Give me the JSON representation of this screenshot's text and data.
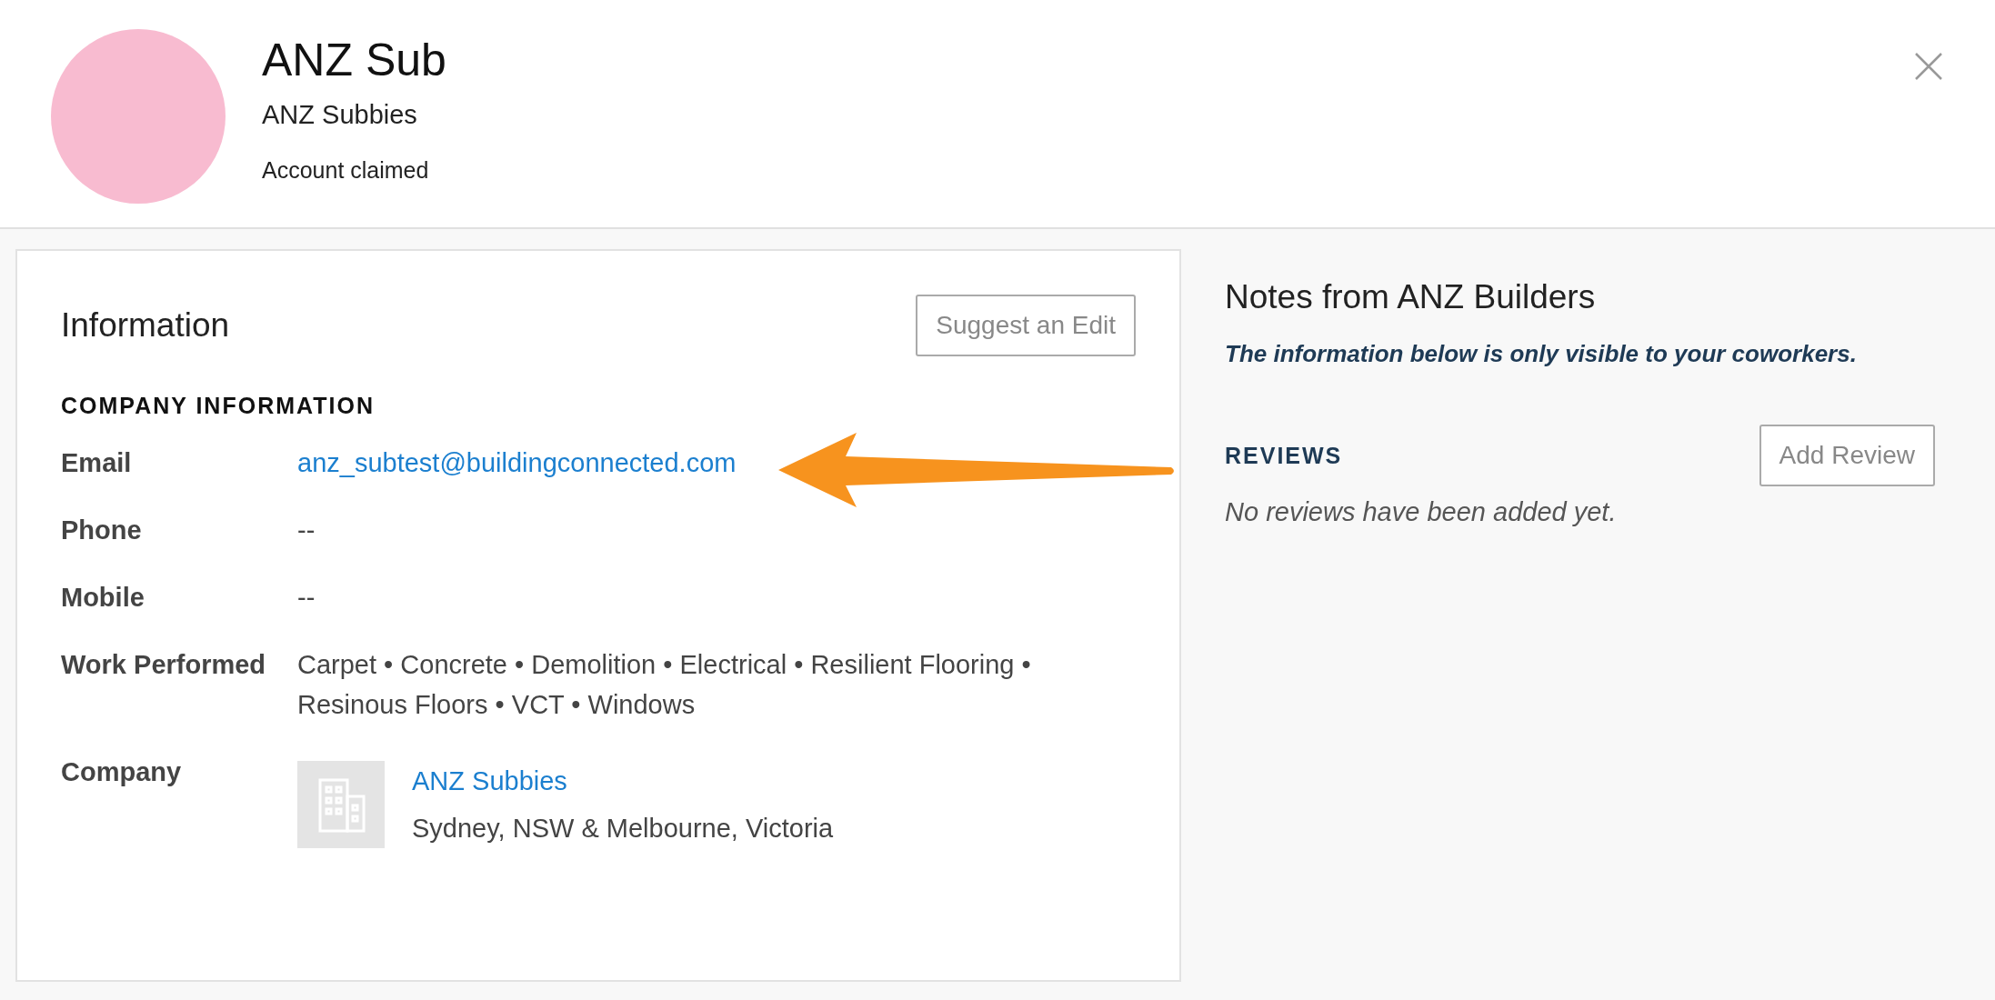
{
  "header": {
    "title": "ANZ Sub",
    "subtitle": "ANZ Subbies",
    "status": "Account claimed"
  },
  "information": {
    "title": "Information",
    "edit_button": "Suggest an Edit",
    "section_heading": "COMPANY INFORMATION",
    "rows": [
      {
        "label": "Email",
        "kind": "link",
        "value": "anz_subtest@buildingconnected.com"
      },
      {
        "label": "Phone",
        "kind": "text",
        "value": "--"
      },
      {
        "label": "Mobile",
        "kind": "text",
        "value": "--"
      },
      {
        "label": "Work Performed",
        "kind": "text",
        "value": "Carpet • Concrete • Demolition • Electrical • Resilient Flooring • Resinous Floors • VCT • Windows"
      },
      {
        "label": "Company",
        "kind": "company",
        "name": "ANZ Subbies",
        "location": "Sydney, NSW & Melbourne, Victoria"
      }
    ]
  },
  "notes": {
    "title": "Notes from ANZ Builders",
    "notice": "The information below is only visible to your coworkers.",
    "reviews_heading": "REVIEWS",
    "add_button": "Add Review",
    "empty_message": "No reviews have been added yet."
  }
}
